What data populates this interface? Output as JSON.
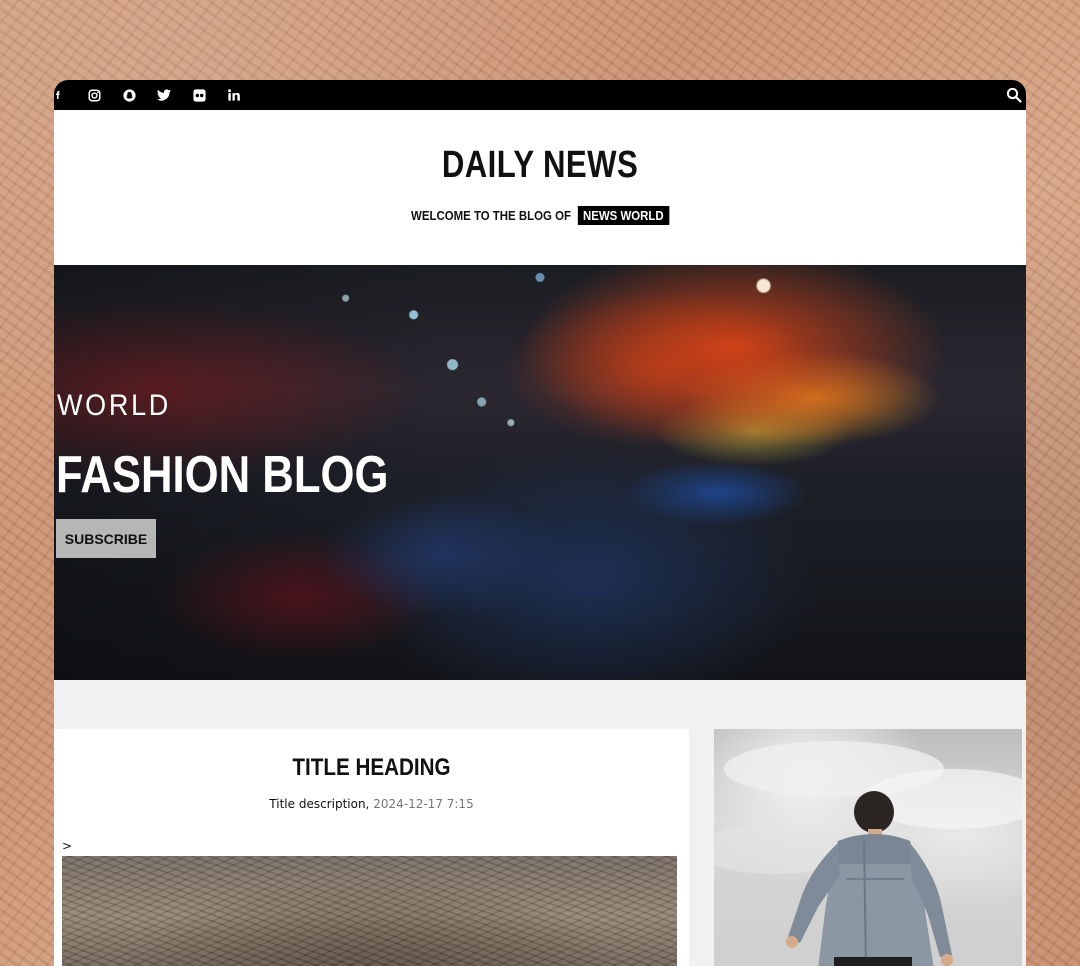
{
  "topbar": {
    "social_icons": [
      "facebook-icon",
      "instagram-icon",
      "snapchat-icon",
      "twitter-icon",
      "flickr-icon",
      "linkedin-icon"
    ],
    "social_links": [
      "f",
      "instagram",
      "snapchat",
      "twitter",
      "flickr",
      "in"
    ],
    "search_icon": "search-icon"
  },
  "masthead": {
    "title": "DAILY NEWS",
    "tagline_prefix": "WELCOME TO THE BLOG OF",
    "tagline_highlight": "NEWS WORLD"
  },
  "hero": {
    "kicker": "WORLD",
    "title": "FASHION BLOG",
    "subscribe_label": "SUBSCRIBE"
  },
  "post": {
    "title": "TITLE HEADING",
    "description": "Title description,",
    "date": "2024-12-17 7:15",
    "marker": ">"
  },
  "colors": {
    "topbar": "#000000",
    "accent_chip": "#000000",
    "page_background": "#f1f1f1",
    "paper_background": "#cf9a7a"
  }
}
